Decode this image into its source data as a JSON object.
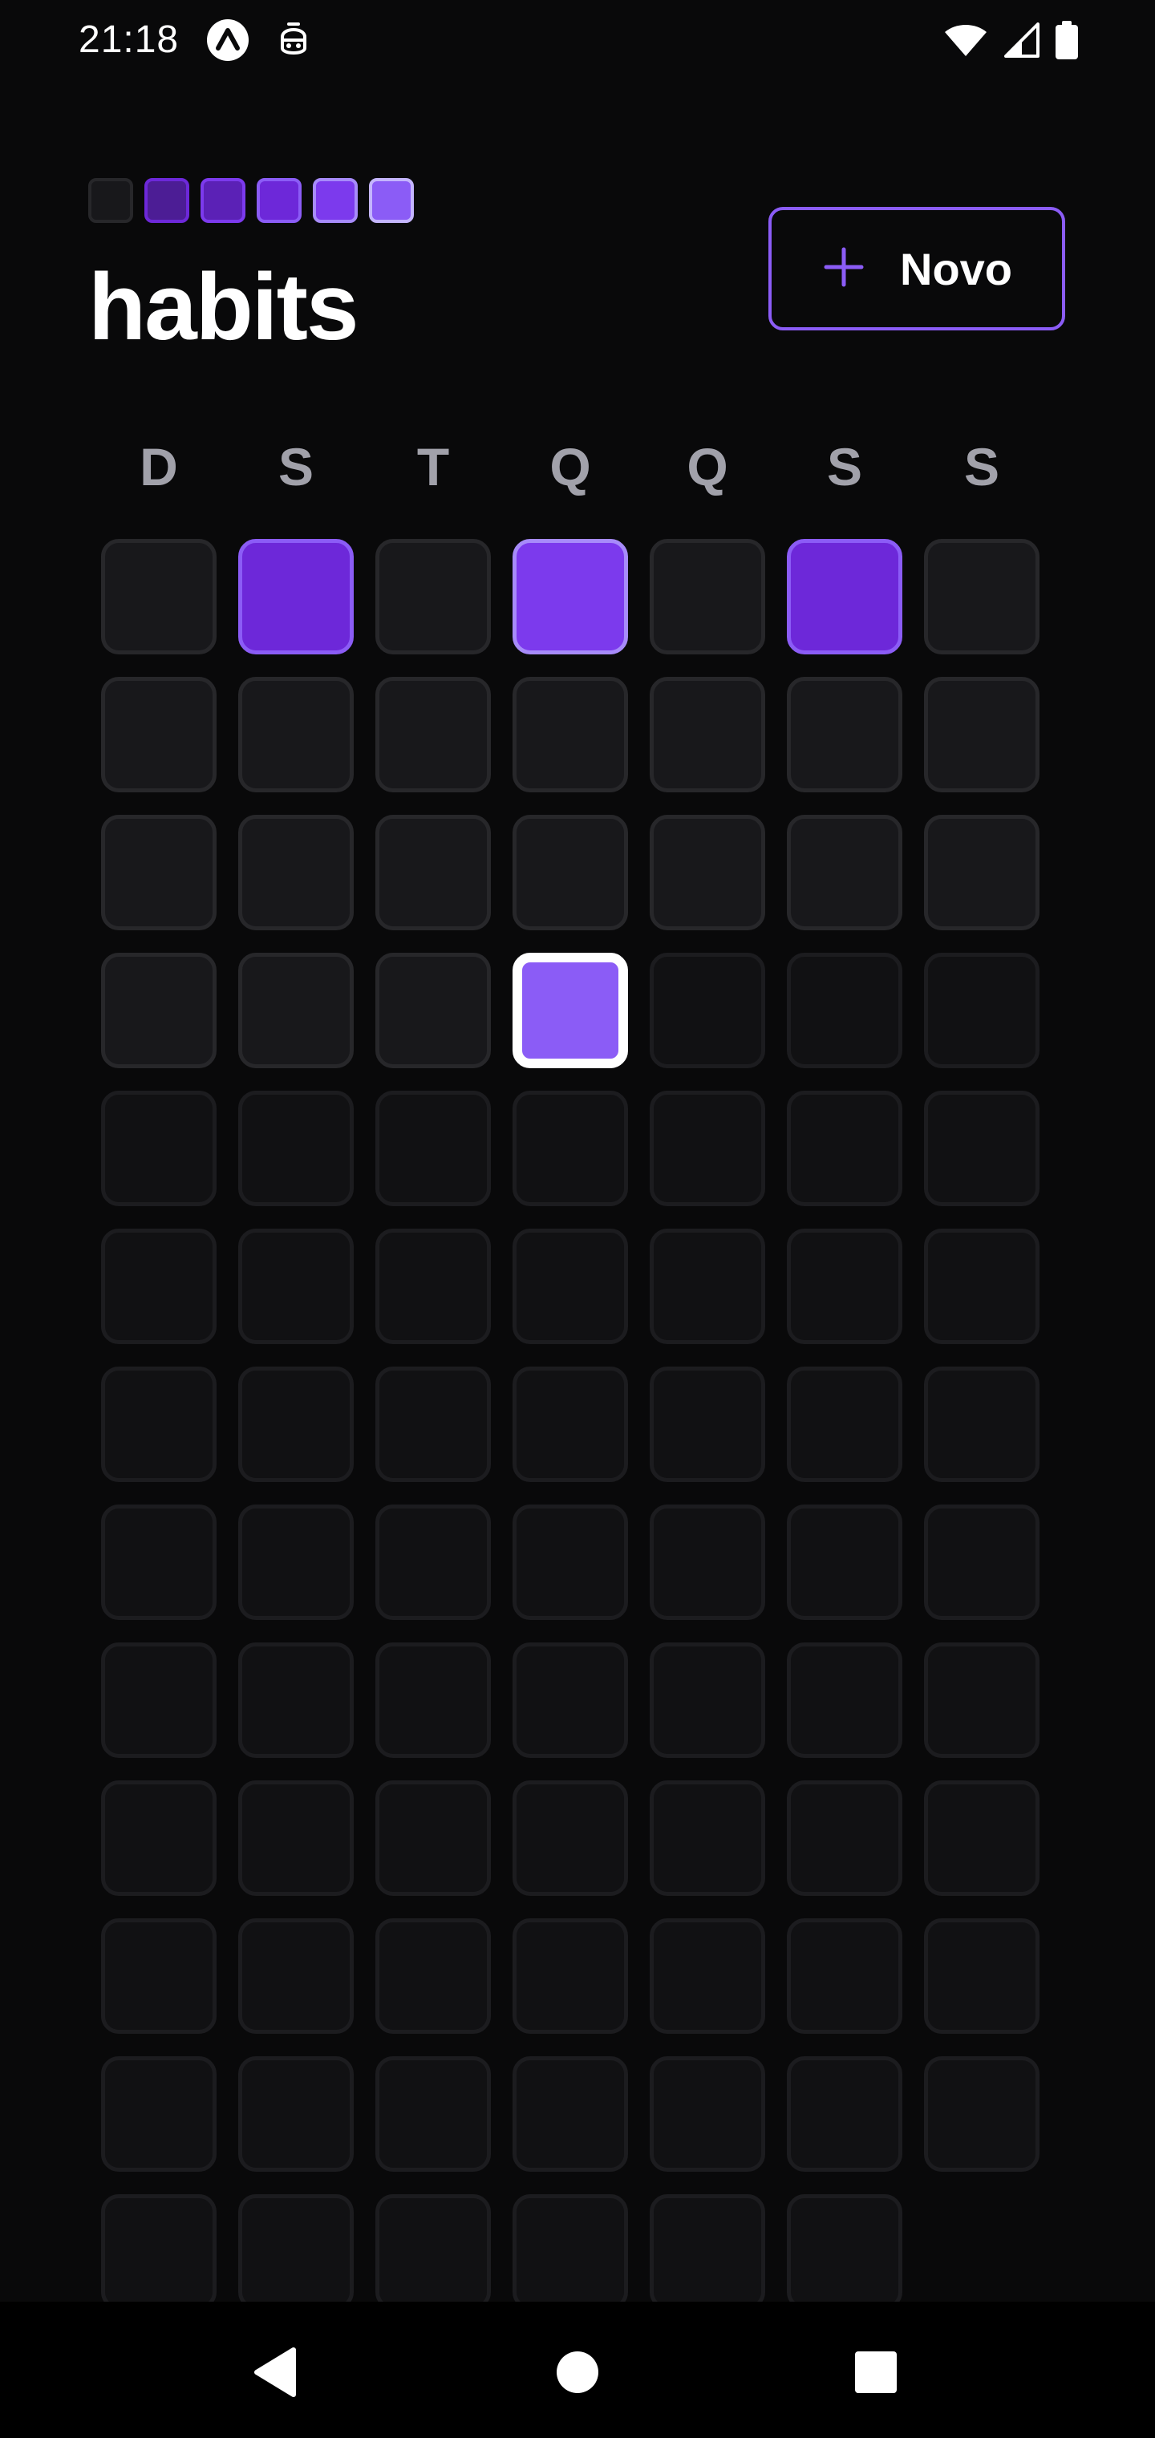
{
  "status_bar": {
    "time": "21:18",
    "left_icons": [
      "expo-go-icon",
      "bot-notification-icon"
    ],
    "right_icons": [
      "wifi-icon",
      "cellular-signal-icon",
      "battery-icon"
    ]
  },
  "header": {
    "logo_colors": [
      "#18181b",
      "#4c1d95",
      "#5b21b6",
      "#6d28d9",
      "#7c3aed",
      "#8b5cf6"
    ],
    "title": "habits",
    "new_button": {
      "label": "Novo",
      "icon": "plus-icon"
    }
  },
  "week_days": [
    "D",
    "S",
    "T",
    "Q",
    "Q",
    "S",
    "S"
  ],
  "grid": {
    "columns": 7,
    "rows": 13,
    "visible_cells": 90,
    "past_days_shown": 25,
    "today_index": 24,
    "day_levels": {
      "1": 3,
      "3": 4,
      "5": 3,
      "24": 5
    }
  },
  "colors": {
    "background": "#09090a",
    "accent": "#8b5cf6",
    "cell_empty": "#18181b",
    "cell_empty_border": "#27272a",
    "cell_future": "#111113",
    "cell_future_border": "#1c1c1f",
    "today_border": "#ffffff",
    "week_day_text": "#a1a1aa",
    "level_colors": [
      "#18181b",
      "#4c1d95",
      "#5b21b6",
      "#6d28d9",
      "#7c3aed",
      "#8b5cf6"
    ],
    "level_borders": [
      "#27272a",
      "#6d28d9",
      "#7c3aed",
      "#8b5cf6",
      "#a78bfa",
      "#c4b5fd"
    ]
  },
  "nav_bar": {
    "icons": [
      "back-icon",
      "home-icon",
      "recents-icon"
    ]
  }
}
